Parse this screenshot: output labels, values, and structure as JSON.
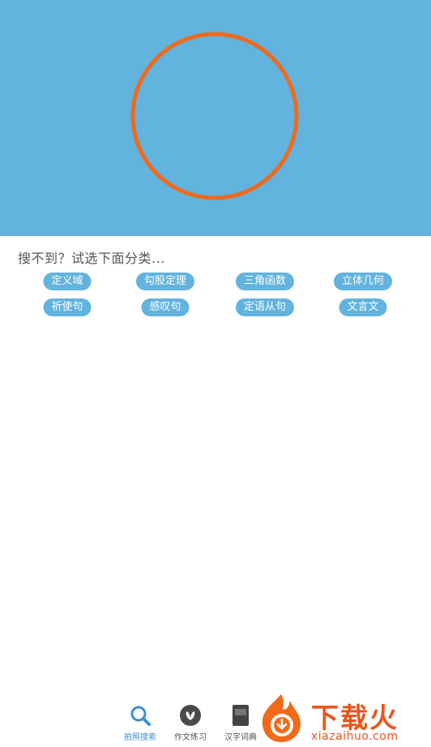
{
  "hero": {
    "ring_color": "#f06a1a",
    "background": "#62b3dd"
  },
  "prompt": "搜不到？试选下面分类...",
  "chips": [
    [
      "定义域",
      "勾股定理",
      "三角函数",
      "立体几何"
    ],
    [
      "祈使句",
      "感叹句",
      "定语从句",
      "文言文"
    ]
  ],
  "nav": [
    {
      "label": "拍照搜索",
      "icon": "search-icon",
      "active": true
    },
    {
      "label": "作文练习",
      "icon": "leaf-icon",
      "active": false
    },
    {
      "label": "汉字词典",
      "icon": "dictionary-icon",
      "active": false
    }
  ],
  "watermark": {
    "text": "下载火",
    "url": "xiazaihuo.com"
  }
}
